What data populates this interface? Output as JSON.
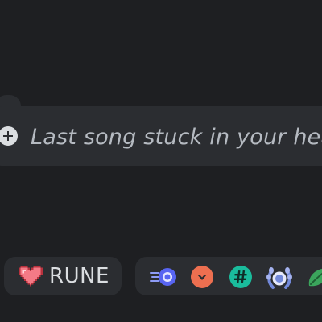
{
  "status": {
    "placeholder": "Last song stuck in your hea",
    "add_icon": "plus-circle-icon"
  },
  "tag": {
    "label": "RUNE",
    "icon": "pixel-heart-icon"
  },
  "badges": [
    {
      "name": "speed-orb-badge-icon",
      "color": "#5865f2"
    },
    {
      "name": "chevron-badge-icon",
      "color": "#ed6f50"
    },
    {
      "name": "hashtag-badge-icon",
      "color": "#1abc9c"
    },
    {
      "name": "laurel-badge-icon",
      "color": "#7289da"
    },
    {
      "name": "leaf-badge-icon",
      "color": "#3ba55c"
    }
  ],
  "colors": {
    "background": "#1e1f22",
    "surface": "#2b2d31",
    "text_muted": "#b5bac1",
    "text": "#dbdee1"
  }
}
